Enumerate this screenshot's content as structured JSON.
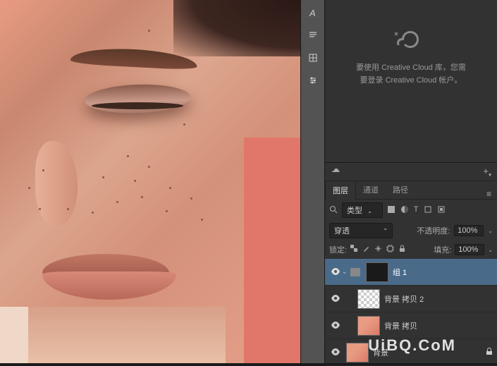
{
  "cc_message": "要使用 Creative Cloud 库，您需要登录 Creative Cloud 帐户。",
  "tabs": {
    "layers": "图层",
    "channels": "通道",
    "paths": "路径"
  },
  "filter": {
    "kind": "类型"
  },
  "blend": {
    "mode": "穿透",
    "opacity_label": "不透明度:",
    "opacity_value": "100%"
  },
  "lock": {
    "label": "锁定:",
    "fill_label": "填充:",
    "fill_value": "100%"
  },
  "layers": {
    "group1": "组 1",
    "bgcopy2": "背景 拷贝 2",
    "bgcopy": "背景 拷贝",
    "bg": "背景"
  },
  "watermark": "UiBQ.CoM"
}
